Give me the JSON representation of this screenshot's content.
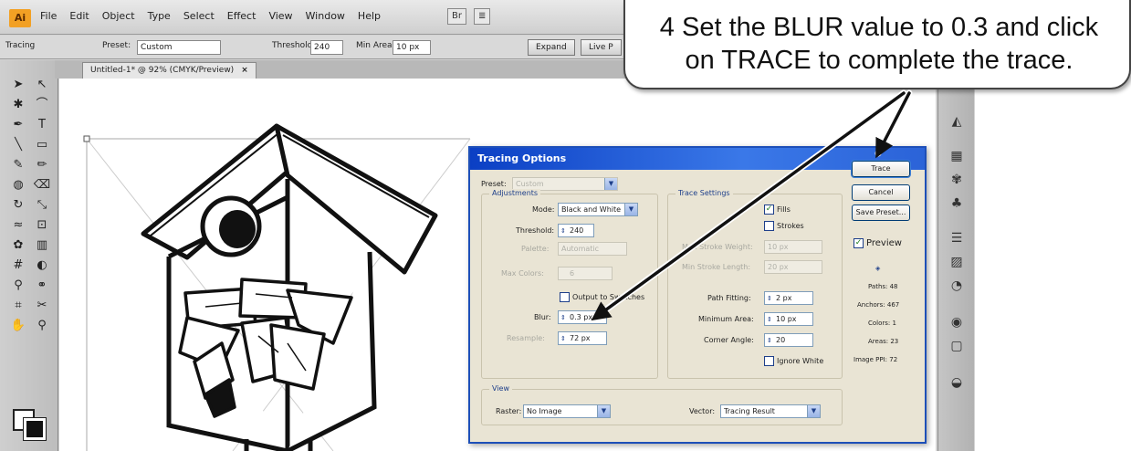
{
  "menubar": {
    "app_logo": "Ai",
    "items": [
      "File",
      "Edit",
      "Object",
      "Type",
      "Select",
      "Effect",
      "View",
      "Window",
      "Help"
    ],
    "extra": [
      "Br",
      "≣"
    ]
  },
  "controlbar": {
    "mode": "Tracing",
    "preset_label": "Preset:",
    "preset_value": "Custom",
    "threshold_label": "Threshold:",
    "threshold_value": "240",
    "min_area_label": "Min Area:",
    "min_area_value": "10 px",
    "expand_button": "Expand",
    "live_button": "Live P"
  },
  "document_tab": {
    "title": "Untitled-1* @ 92% (CMYK/Preview)",
    "close": "×"
  },
  "dialog": {
    "title": "Tracing Options",
    "preset_label": "Preset:",
    "preset_value": "Custom",
    "adjustments_title": "Adjustments",
    "mode_label": "Mode:",
    "mode_value": "Black and White",
    "threshold_label": "Threshold:",
    "threshold_value": "240",
    "palette_label": "Palette:",
    "palette_value": "Automatic",
    "max_colors_label": "Max Colors:",
    "max_colors_value": "6",
    "output_swatches_label": "Output to Swatches",
    "blur_label": "Blur:",
    "blur_value": "0.3 px",
    "resample_label": "Resample:",
    "resample_value": "72 px",
    "trace_settings_title": "Trace Settings",
    "fills_label": "Fills",
    "strokes_label": "Strokes",
    "max_stroke_weight_label": "Max Stroke Weight:",
    "max_stroke_weight_value": "10 px",
    "min_stroke_length_label": "Min Stroke Length:",
    "min_stroke_length_value": "20 px",
    "path_fitting_label": "Path Fitting:",
    "path_fitting_value": "2 px",
    "minimum_area_label": "Minimum Area:",
    "minimum_area_value": "10 px",
    "corner_angle_label": "Corner Angle:",
    "corner_angle_value": "20",
    "ignore_white_label": "Ignore White",
    "view_title": "View",
    "raster_label": "Raster:",
    "raster_value": "No Image",
    "vector_label": "Vector:",
    "vector_value": "Tracing Result",
    "trace_button": "Trace",
    "cancel_button": "Cancel",
    "save_preset_button": "Save Preset...",
    "preview_label": "Preview",
    "stats": {
      "paths": "Paths: 48",
      "anchors": "Anchors: 467",
      "colors": "Colors: 1",
      "areas": "Areas: 23",
      "image_ppi": "Image PPI: 72"
    }
  },
  "callout": {
    "line1": "4  Set the BLUR value to 0.3 and click",
    "line2": "on TRACE to complete the trace."
  }
}
